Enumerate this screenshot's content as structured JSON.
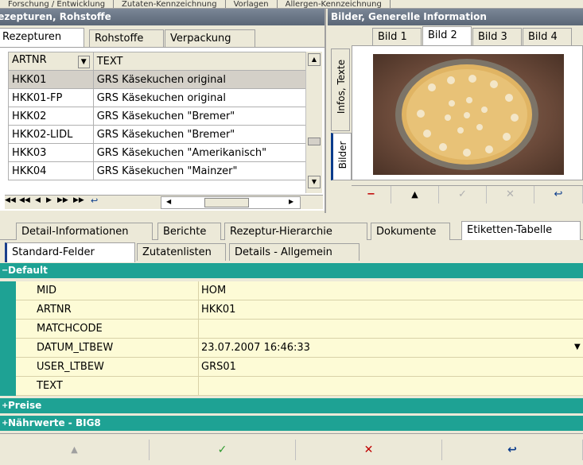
{
  "top_tabs_partial": [
    "Forschung / Entwicklung",
    "Zutaten-Kennzeichnung",
    "Vorlagen",
    "Allergen-Kennzeichnung"
  ],
  "left_panel": {
    "title": "Rezepturen, Rohstoffe",
    "tabs": [
      "Rezepturen",
      "Rohstoffe",
      "Verpackung"
    ],
    "active_tab": 0,
    "columns": [
      "ARTNR",
      "TEXT"
    ],
    "rows": [
      {
        "artnr": "HKK01",
        "text": "GRS Käsekuchen original"
      },
      {
        "artnr": "HKK01-FP",
        "text": "GRS Käsekuchen original"
      },
      {
        "artnr": "HKK02",
        "text": "GRS Käsekuchen \"Bremer\""
      },
      {
        "artnr": "HKK02-LIDL",
        "text": "GRS Käsekuchen \"Bremer\""
      },
      {
        "artnr": "HKK03",
        "text": "GRS Käsekuchen \"Amerikanisch\""
      },
      {
        "artnr": "HKK04",
        "text": "GRS Käsekuchen \"Mainzer\""
      }
    ]
  },
  "right_panel": {
    "title": "Bilder, Generelle Information",
    "vertical_tabs": [
      "Infos, Texte",
      "Bilder"
    ],
    "image_tabs": [
      "Bild 1",
      "Bild 2",
      "Bild 3",
      "Bild 4"
    ],
    "active_image_tab": 1,
    "image_alt": "Käsekuchen"
  },
  "detail_tabs": [
    "Detail-Informationen",
    "Berichte",
    "Rezeptur-Hierarchie",
    "Dokumente",
    "Etiketten-Tabelle"
  ],
  "active_detail_tab": 4,
  "sub_tabs": [
    "Standard-Felder",
    "Zutatenlisten",
    "Details - Allgemein"
  ],
  "active_sub_tab": 0,
  "property_grid": {
    "category_default": "Default",
    "fields": [
      {
        "name": "MID",
        "value": "HOM"
      },
      {
        "name": "ARTNR",
        "value": "HKK01"
      },
      {
        "name": "MATCHCODE",
        "value": ""
      },
      {
        "name": "DATUM_LTBEW",
        "value": "23.07.2007 16:46:33"
      },
      {
        "name": "USER_LTBEW",
        "value": "GRS01"
      },
      {
        "name": "TEXT",
        "value": ""
      }
    ],
    "category_preise": "Preise",
    "category_naehrwerte": "Nährwerte - BIG8"
  },
  "colors": {
    "category_teal": "#1ea294",
    "property_yellow": "#fdfbd6",
    "header_gray": "#5b6777"
  }
}
